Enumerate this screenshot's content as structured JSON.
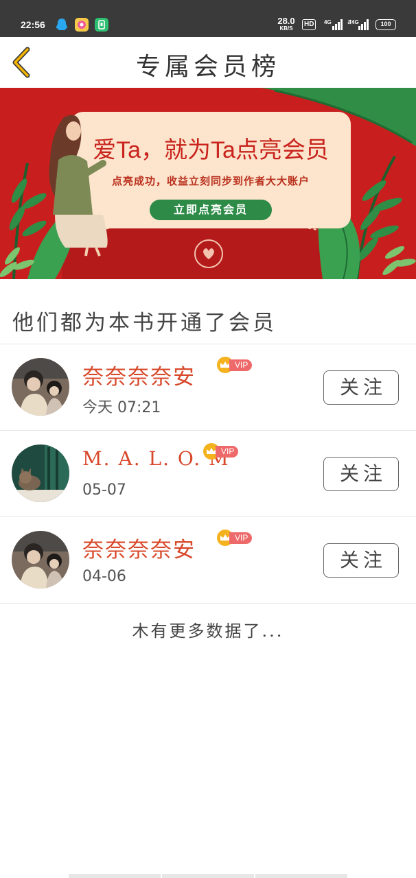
{
  "status_bar": {
    "time": "22:56",
    "speed_value": "28.0",
    "speed_unit": "KB/S",
    "hd_label": "HD",
    "network_1": "4G",
    "network_2": "4G",
    "battery": "100"
  },
  "header": {
    "title": "专属会员榜",
    "back_icon": "chevron-left-icon",
    "accent_color": "#f4b400"
  },
  "banner": {
    "title": "爱Ta，就为Ta点亮会员",
    "subtitle": "点亮成功，收益立刻同步到作者大大账户",
    "button_label": "立即点亮会员",
    "background_color": "#c81f1e",
    "button_color": "#2d8b47"
  },
  "section": {
    "title": "他们都为本书开通了会员"
  },
  "members": [
    {
      "name": "奈奈奈奈安",
      "badge": "VIP",
      "time": "今天 07:21",
      "follow_label": "关注"
    },
    {
      "name": "M. A. L. O. M",
      "badge": "VIP",
      "time": "05-07",
      "follow_label": "关注"
    },
    {
      "name": "奈奈奈奈安",
      "badge": "VIP",
      "time": "04-06",
      "follow_label": "关注"
    }
  ],
  "footer": {
    "no_more": "木有更多数据了..."
  },
  "colors": {
    "name_color": "#d8482a",
    "vip_badge_color": "#ee6a6a",
    "crown_color": "#f5b21f"
  }
}
